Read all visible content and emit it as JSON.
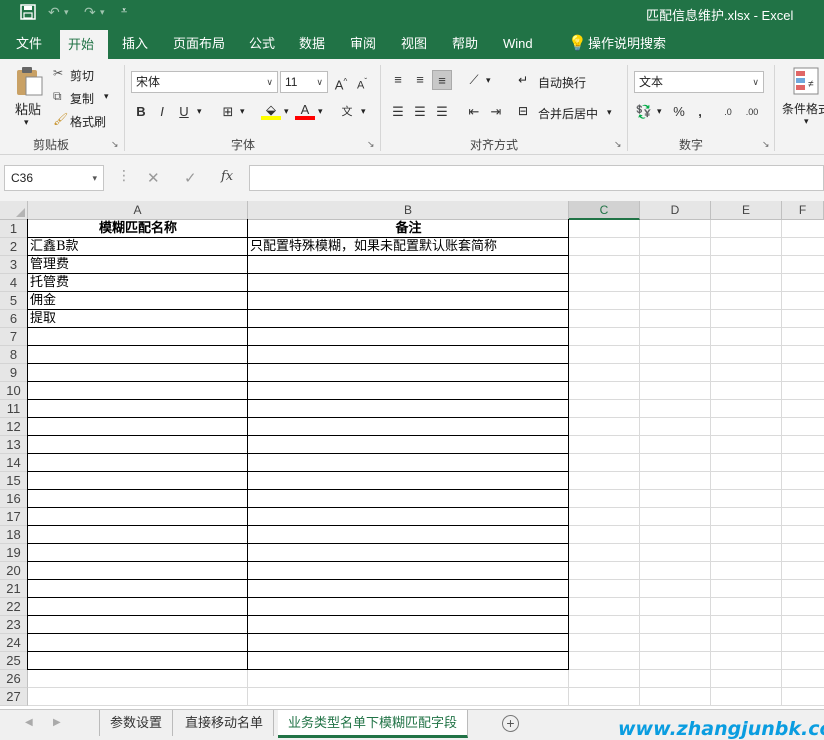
{
  "window": {
    "title": "匹配信息维护.xlsx  -  Excel",
    "qa_icons": [
      "save-icon",
      "undo-icon",
      "redo-icon",
      "customize-icon"
    ]
  },
  "ribbon_tabs": [
    "文件",
    "开始",
    "插入",
    "页面布局",
    "公式",
    "数据",
    "审阅",
    "视图",
    "帮助",
    "Wind",
    "操作说明搜索"
  ],
  "active_tab": "开始",
  "clipboard": {
    "paste": "粘贴",
    "cut": "剪切",
    "copy": "复制",
    "format_painter": "格式刷",
    "label": "剪贴板"
  },
  "font": {
    "name": "宋体",
    "size": "11",
    "bold": "B",
    "italic": "I",
    "underline": "U",
    "label": "字体",
    "font_color_accent": "#ff0000",
    "fill_color_accent": "#ffff00"
  },
  "alignment": {
    "wrap": "自动换行",
    "merge": "合并后居中",
    "label": "对齐方式"
  },
  "number": {
    "format": "文本",
    "percent": "%",
    "comma": ",",
    "label": "数字"
  },
  "styles": {
    "conditional": "条件格式"
  },
  "formula_bar": {
    "name_box": "C36",
    "fx": "fx",
    "value": ""
  },
  "columns": [
    "A",
    "B",
    "C",
    "D",
    "E",
    "F"
  ],
  "selected_column": "C",
  "rows": [
    "1",
    "2",
    "3",
    "4",
    "5",
    "6",
    "7",
    "8",
    "9",
    "10",
    "11",
    "12",
    "13",
    "14",
    "15",
    "16",
    "17",
    "18",
    "19",
    "20",
    "21",
    "22",
    "23",
    "24",
    "25",
    "26",
    "27"
  ],
  "table": {
    "headers": [
      "模糊匹配名称",
      "备注"
    ],
    "rows": [
      [
        "汇鑫B款",
        "只配置特殊模糊，如果未配置默认账套简称"
      ],
      [
        "管理费",
        ""
      ],
      [
        "托管费",
        ""
      ],
      [
        "佣金",
        ""
      ],
      [
        "提取",
        ""
      ]
    ]
  },
  "sheets": [
    "参数设置",
    "直接移动名单",
    "业务类型名单下模糊匹配字段"
  ],
  "active_sheet": "业务类型名单下模糊匹配字段",
  "watermark": "www.zhangjunbk.com",
  "colors": {
    "accent": "#217346",
    "watermark": "#0a9de0"
  }
}
